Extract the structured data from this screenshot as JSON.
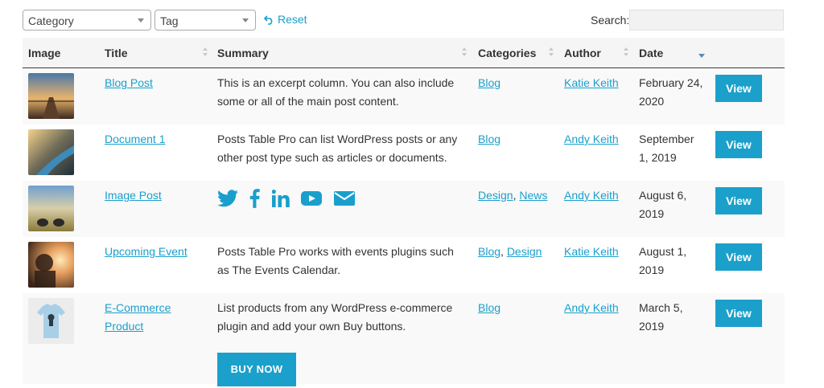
{
  "filters": {
    "category": "Category",
    "tag": "Tag",
    "reset": "Reset",
    "search_label": "Search:",
    "search_value": ""
  },
  "columns": [
    "Image",
    "Title",
    "Summary",
    "Categories",
    "Author",
    "Date"
  ],
  "rows": [
    {
      "title": "Blog Post",
      "summary": "This is an excerpt column. You can also include some or all of the main post content.",
      "categories": [
        "Blog"
      ],
      "author": "Katie Keith",
      "date": "February 24, 2020",
      "button": "View"
    },
    {
      "title": "Document 1",
      "summary": "Posts Table Pro can list WordPress posts or any other post type such as articles or documents.",
      "categories": [
        "Blog"
      ],
      "author": "Andy Keith",
      "date": "September 1, 2019",
      "button": "View"
    },
    {
      "title": "Image Post",
      "summary_icons": [
        "twitter-icon",
        "facebook-icon",
        "linkedin-icon",
        "youtube-icon",
        "mail-icon"
      ],
      "categories": [
        "Design",
        "News"
      ],
      "author": "Andy Keith",
      "date": "August 6, 2019",
      "button": "View"
    },
    {
      "title": "Upcoming Event",
      "summary": "Posts Table Pro works with events plugins such as The Events Calendar.",
      "categories": [
        "Blog",
        "Design"
      ],
      "author": "Katie Keith",
      "date": "August 1, 2019",
      "button": "View"
    },
    {
      "title": "E-Commerce Product",
      "summary": "List products from any WordPress e-commerce plugin and add your own Buy buttons.",
      "categories": [
        "Blog"
      ],
      "author": "Andy Keith",
      "date": "March 5, 2019",
      "button": "View",
      "buy_button": "BUY NOW"
    }
  ],
  "colors": {
    "accent": "#1ba0cb",
    "link": "#1a9fcc",
    "header_bg": "#f5f5f5",
    "row_alt": "#f9f9f9"
  }
}
